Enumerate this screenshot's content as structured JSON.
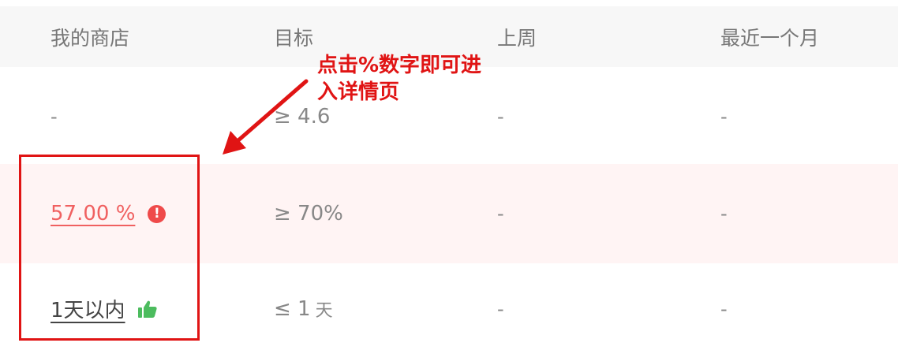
{
  "columns": [
    "我的商店",
    "目标",
    "上周",
    "最近一个月"
  ],
  "rows": [
    {
      "my_store": "-",
      "goal": "≥ 4.6",
      "last_week": "-",
      "last_month": "-"
    },
    {
      "my_store": "57.00 %",
      "goal": "≥ 70%",
      "last_week": "-",
      "last_month": "-",
      "status_icon": "warning-icon"
    },
    {
      "my_store": "1天以内",
      "goal_prefix": "≤ 1",
      "goal_unit": "天",
      "last_week": "-",
      "last_month": "-",
      "status_icon": "thumbs-up-icon"
    }
  ],
  "annotation": {
    "text": "点击%数字即可进\n入详情页",
    "color": "#e01414"
  },
  "colors": {
    "alert_red": "#f06060",
    "warning_icon": "#ef4a4a",
    "thumbs_up": "#4cbc5e",
    "alert_row_bg": "#fff4f4",
    "header_bg": "#f7f7f7"
  }
}
